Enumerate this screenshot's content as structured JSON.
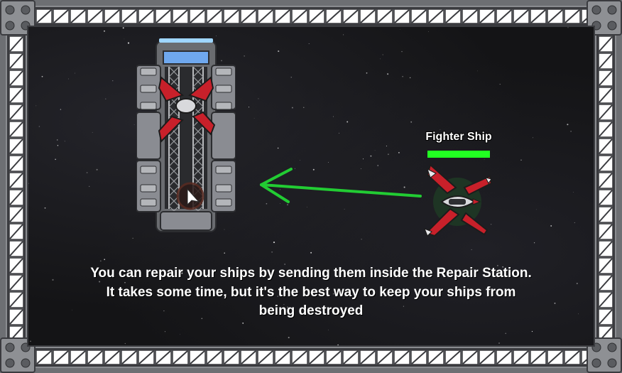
{
  "unit": {
    "name": "Fighter Ship",
    "health_fraction": 1.0,
    "health_color": "#22ff22"
  },
  "tutorial": {
    "line1": "You can repair your ships by sending them inside the Repair Station.",
    "line2": "It takes some time, but it's the best way to keep your ships from",
    "line3": "being destroyed"
  },
  "colors": {
    "arrow": "#22cc33",
    "ship_red": "#c8202a",
    "frame_grey": "#6d6f73"
  },
  "icons": {
    "station": "repair-station-icon",
    "ship": "fighter-ship-icon",
    "cursor": "mouse-cursor-icon",
    "arrow": "direction-arrow-icon"
  }
}
